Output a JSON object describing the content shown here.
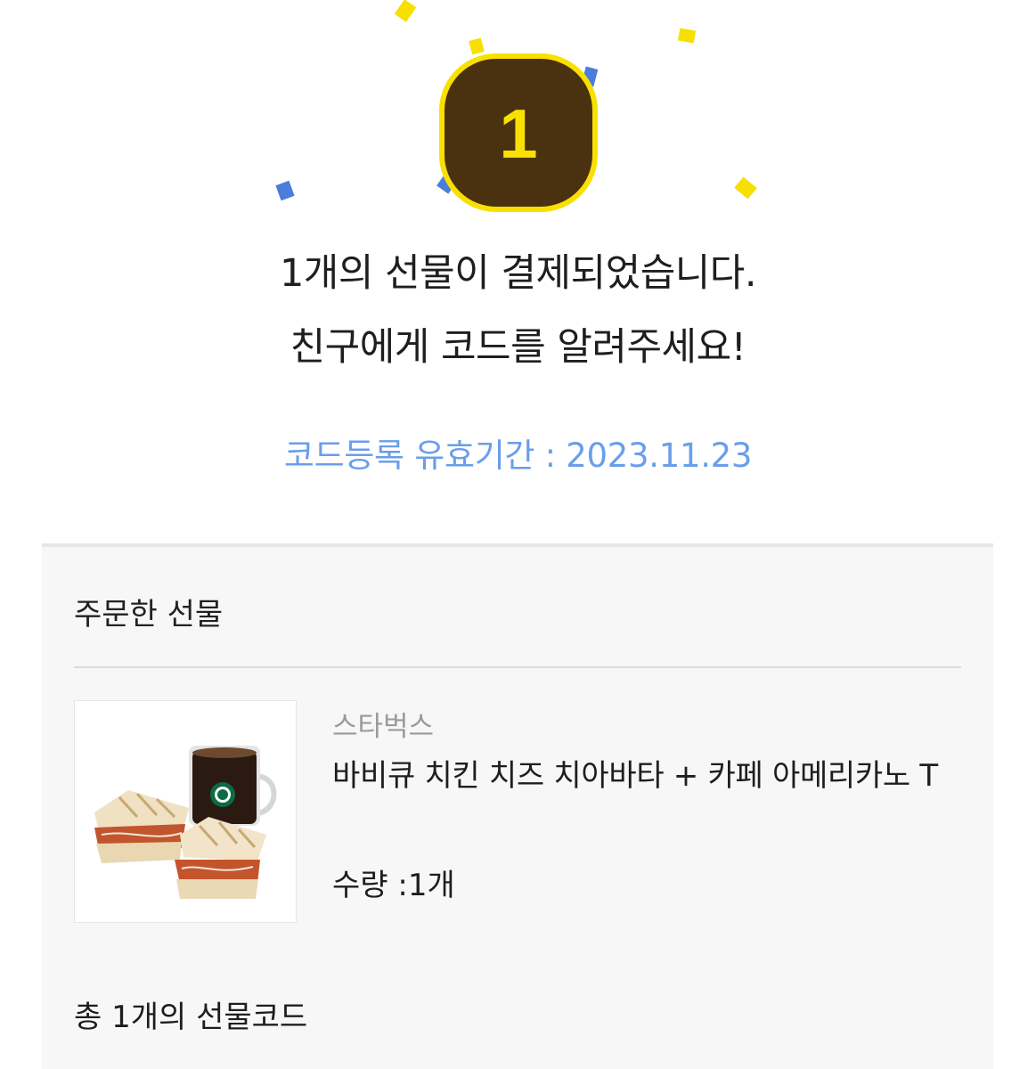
{
  "badge": {
    "count": "1"
  },
  "confetti_colors": {
    "yellow": "#f7e000",
    "blue": "#4c7ddb"
  },
  "headline": {
    "line1": "1개의 선물이 결제되었습니다.",
    "line2": "친구에게 코드를 알려주세요!"
  },
  "validity": "코드등록 유효기간 : 2023.11.23",
  "order": {
    "section_title": "주문한 선물",
    "items": [
      {
        "brand": "스타벅스",
        "name": "바비큐 치킨 치즈 치아바타 + 카페 아메리카노 T",
        "quantity_label": "수량 : ",
        "quantity_value": "1개",
        "image_icon": "sandwich-coffee-image"
      }
    ],
    "total_codes": "총 1개의 선물코드"
  },
  "colors": {
    "accent_text": "#6a9eea",
    "badge_fill": "#4a3210",
    "badge_border": "#f9e000",
    "section_bg": "#f7f7f7"
  }
}
